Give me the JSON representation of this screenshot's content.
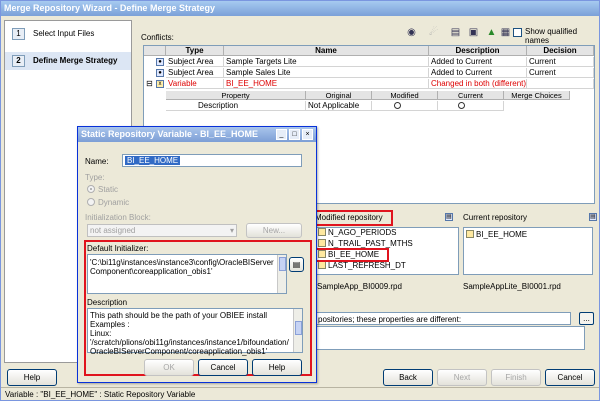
{
  "window": {
    "title": "Merge Repository Wizard - Define Merge Strategy"
  },
  "steps": [
    {
      "num": "1",
      "label": "Select Input Files"
    },
    {
      "num": "2",
      "label": "Define Merge Strategy"
    }
  ],
  "conflicts": {
    "label": "Conflicts:",
    "show_qualified_label": "Show qualified names",
    "columns": [
      "Type",
      "Name",
      "Description",
      "Decision"
    ],
    "rows": [
      {
        "type": "Subject Area",
        "name": "Sample Targets Lite",
        "description": "Added to Current",
        "decision": "Current"
      },
      {
        "type": "Subject Area",
        "name": "Sample Sales Lite",
        "description": "Added to Current",
        "decision": "Current"
      },
      {
        "type": "Variable",
        "name": "BI_EE_HOME",
        "description": "Changed in both (different)",
        "decision": ""
      }
    ],
    "sub_columns": [
      "Property",
      "Original",
      "Modified",
      "Current",
      "Merge Choices"
    ],
    "sub_row": {
      "property": "Description",
      "original": "Not Applicable"
    }
  },
  "modified_repo": {
    "label": "Modified repository",
    "items": [
      "N_AGO_PERIODS",
      "N_TRAIL_PAST_MTHS",
      "BI_EE_HOME",
      "LAST_REFRESH_DT"
    ],
    "file": "SampleApp_BI0009.rpd"
  },
  "current_repo": {
    "label": "Current repository",
    "items": [
      "BI_EE_HOME"
    ],
    "file": "SampleAppLite_BI0001.rpd"
  },
  "properties_message": "positories; these properties are different:",
  "buttons": {
    "help": "Help",
    "back": "Back",
    "next": "Next",
    "finish": "Finish",
    "cancel": "Cancel"
  },
  "status": "Variable : \"BI_EE_HOME\" : Static Repository Variable",
  "dialog": {
    "title": "Static Repository Variable - BI_EE_HOME",
    "name_label": "Name:",
    "name_value": "BI_EE_HOME",
    "type_label": "Type:",
    "static_label": "Static",
    "dynamic_label": "Dynamic",
    "init_block_label": "Initialization Block:",
    "init_block_value": "not assigned",
    "new_button": "New...",
    "default_init_label": "Default Initializer:",
    "default_init_text": "'C:\\bi11g\\instances\\instance3\\config\\OracleBIServerComponent\\coreapplication_obis1'",
    "description_label": "Description",
    "description_text": "This path should be the path of your OBIEE install\nExamples :\nLinux:\n'/scratch/plions/obi11g/instances/instance1/bifoundation/OracleBIServerComponent/coreapplication_obis1'",
    "ok": "OK",
    "cancel": "Cancel",
    "help": "Help"
  }
}
